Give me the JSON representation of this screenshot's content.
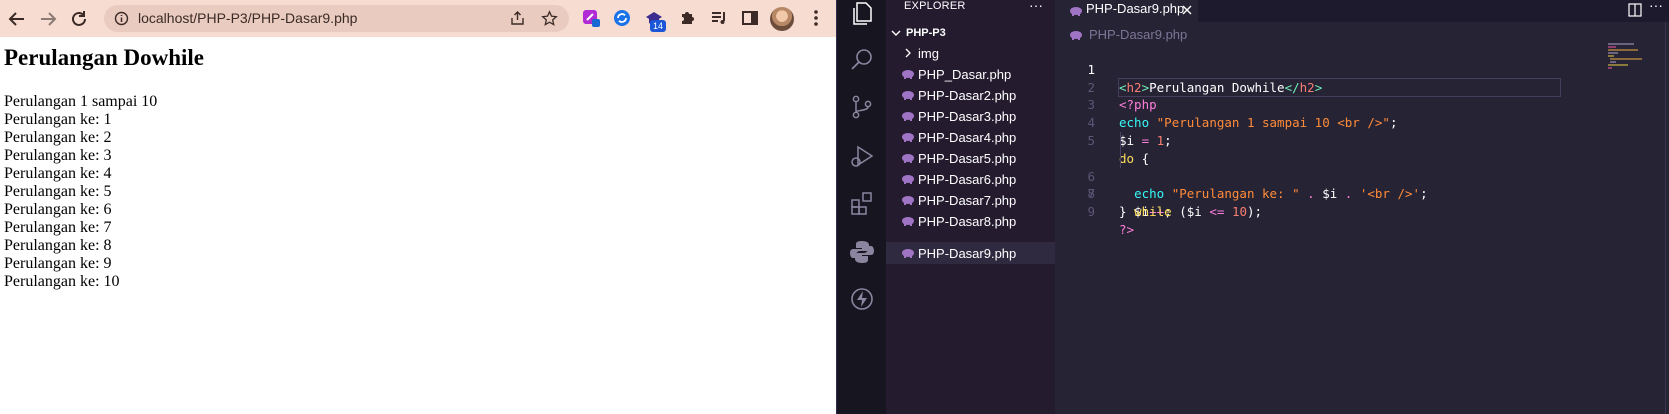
{
  "browser": {
    "url": "localhost/PHP-P3/PHP-Dasar9.php",
    "extension_badge": "14",
    "colors": {
      "toolbar": "#f7dcd2",
      "omnibox": "#e9cbc0"
    }
  },
  "page": {
    "heading": "Perulangan Dowhile",
    "lines": [
      "Perulangan 1 sampai 10",
      "Perulangan ke: 1",
      "Perulangan ke: 2",
      "Perulangan ke: 3",
      "Perulangan ke: 4",
      "Perulangan ke: 5",
      "Perulangan ke: 6",
      "Perulangan ke: 7",
      "Perulangan ke: 8",
      "Perulangan ke: 9",
      "Perulangan ke: 10"
    ]
  },
  "vscode": {
    "theme_colors": {
      "editor_bg": "#262335",
      "sidebar_bg": "#241b2f",
      "activity_bg": "#171520"
    },
    "explorer": {
      "title": "EXPLORER",
      "more": "···",
      "folder": "PHP-P3",
      "items": [
        {
          "label": "img",
          "type": "folder"
        },
        {
          "label": "PHP_Dasar.php",
          "type": "php"
        },
        {
          "label": "PHP-Dasar2.php",
          "type": "php"
        },
        {
          "label": "PHP-Dasar3.php",
          "type": "php"
        },
        {
          "label": "PHP-Dasar4.php",
          "type": "php"
        },
        {
          "label": "PHP-Dasar5.php",
          "type": "php"
        },
        {
          "label": "PHP-Dasar6.php",
          "type": "php"
        },
        {
          "label": "PHP-Dasar7.php",
          "type": "php"
        },
        {
          "label": "PHP-Dasar8.php",
          "type": "php"
        },
        {
          "label": "PHP-Dasar9.php",
          "type": "php",
          "active": true
        }
      ]
    },
    "tab": {
      "label": "PHP-Dasar9.php"
    },
    "editor_more": "···",
    "breadcrumb": "PHP-Dasar9.php",
    "code": {
      "line_numbers": [
        "1",
        "2",
        "3",
        "4",
        "5",
        "6",
        "7",
        "8",
        "9"
      ],
      "line1": {
        "open_bracket": "<",
        "tag": "h2",
        "close_bracket": ">",
        "text": "Perulangan Dowhile",
        "end_open": "</",
        "end_tag": "h2",
        "end_close": ">"
      },
      "line2": {
        "php_open": "<?php"
      },
      "line3": {
        "echo": "echo",
        "string": "\"Perulangan 1 sampai 10 <br />\"",
        "semi": ";"
      },
      "line4": {
        "var": "$i",
        "op": " = ",
        "num": "1",
        "semi": ";"
      },
      "line5": {
        "kw": "do",
        "brace": " {"
      },
      "line6": {
        "indent": "  ",
        "echo": "echo",
        "string": "\"Perulangan ke: \"",
        "dot1": " . ",
        "var": "$i",
        "dot2": " . ",
        "string2": "'<br />'",
        "semi": ";"
      },
      "line7": {
        "indent": "  ",
        "var": "$i",
        "op": "++",
        "semi": ";"
      },
      "line8": {
        "brace": "} ",
        "kw": "while",
        "paren_open": " (",
        "var": "$i",
        "op": " <= ",
        "num": "10",
        "paren_close": ");"
      },
      "line9": {
        "php_close": "?>"
      }
    }
  }
}
